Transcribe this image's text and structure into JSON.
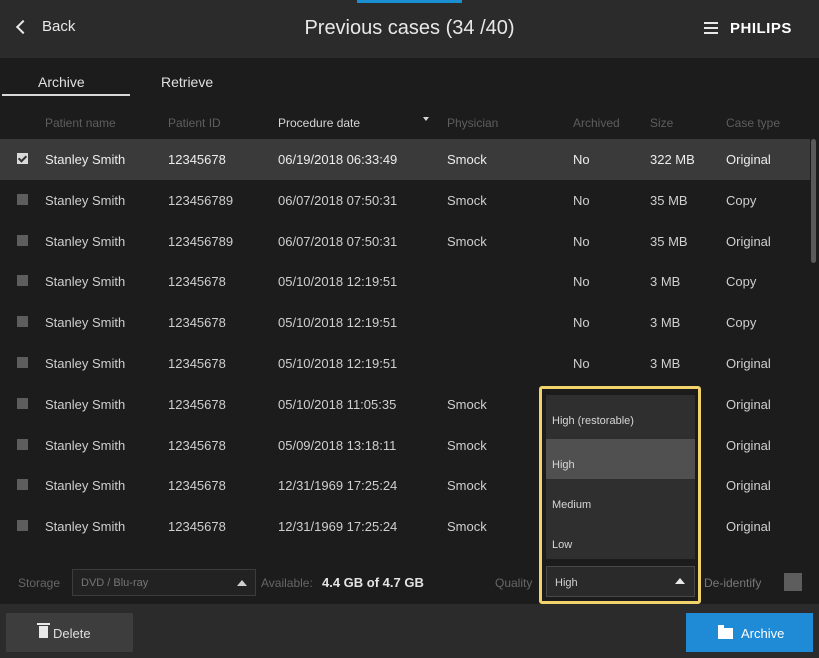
{
  "header": {
    "back_label": "Back",
    "title": "Previous cases (34 /40)",
    "brand": "PHILIPS",
    "back_icon": "chevron-left-icon",
    "menu_icon": "hamburger-menu-icon"
  },
  "tabs": [
    {
      "label": "Archive",
      "active": true
    },
    {
      "label": "Retrieve",
      "active": false
    }
  ],
  "table": {
    "columns": [
      "Patient name",
      "Patient ID",
      "Procedure date",
      "Physician",
      "Archived",
      "Size",
      "Case type"
    ],
    "sort_column": "Procedure date",
    "rows": [
      {
        "checked": true,
        "name": "Stanley Smith",
        "id": "12345678",
        "date": "06/19/2018 06:33:49",
        "physician": "Smock",
        "archived": "No",
        "size": "322 MB",
        "type": "Original"
      },
      {
        "checked": false,
        "name": "Stanley Smith",
        "id": "123456789",
        "date": "06/07/2018 07:50:31",
        "physician": "Smock",
        "archived": "No",
        "size": "35 MB",
        "type": "Copy"
      },
      {
        "checked": false,
        "name": "Stanley Smith",
        "id": "123456789",
        "date": "06/07/2018 07:50:31",
        "physician": "Smock",
        "archived": "No",
        "size": "35 MB",
        "type": "Original"
      },
      {
        "checked": false,
        "name": "Stanley Smith",
        "id": "12345678",
        "date": "05/10/2018 12:19:51",
        "physician": "",
        "archived": "No",
        "size": "3 MB",
        "type": "Copy"
      },
      {
        "checked": false,
        "name": "Stanley Smith",
        "id": "12345678",
        "date": "05/10/2018 12:19:51",
        "physician": "",
        "archived": "No",
        "size": "3 MB",
        "type": "Copy"
      },
      {
        "checked": false,
        "name": "Stanley Smith",
        "id": "12345678",
        "date": "05/10/2018 12:19:51",
        "physician": "",
        "archived": "No",
        "size": "3 MB",
        "type": "Original"
      },
      {
        "checked": false,
        "name": "Stanley Smith",
        "id": "12345678",
        "date": "05/10/2018 11:05:35",
        "physician": "Smock",
        "archived": "",
        "size": "",
        "type": "Original"
      },
      {
        "checked": false,
        "name": "Stanley Smith",
        "id": "12345678",
        "date": "05/09/2018 13:18:11",
        "physician": "Smock",
        "archived": "",
        "size": "",
        "type": "Original"
      },
      {
        "checked": false,
        "name": "Stanley Smith",
        "id": "12345678",
        "date": "12/31/1969 17:25:24",
        "physician": "Smock",
        "archived": "",
        "size": "",
        "type": "Original"
      },
      {
        "checked": false,
        "name": "Stanley Smith",
        "id": "12345678",
        "date": "12/31/1969 17:25:24",
        "physician": "Smock",
        "archived": "",
        "size": "",
        "type": "Original"
      }
    ]
  },
  "storage": {
    "label": "Storage",
    "selected": "DVD / Blu-ray",
    "available_label": "Available:",
    "available_value": "4.4 GB of 4.7 GB",
    "quality_label": "Quality",
    "quality_selected": "High",
    "quality_options": [
      "High (restorable)",
      "High",
      "Medium",
      "Low"
    ],
    "quality_hover": "High",
    "deidentify_label": "De-identify",
    "deidentify_checked": false
  },
  "footer": {
    "delete_label": "Delete",
    "delete_icon": "trash-icon",
    "archive_label": "Archive",
    "archive_icon": "folder-icon"
  },
  "colors": {
    "accent": "#1f8ad6",
    "highlight": "#f2d36b",
    "background": "#1c1c1c",
    "header": "#2b2b2b"
  }
}
